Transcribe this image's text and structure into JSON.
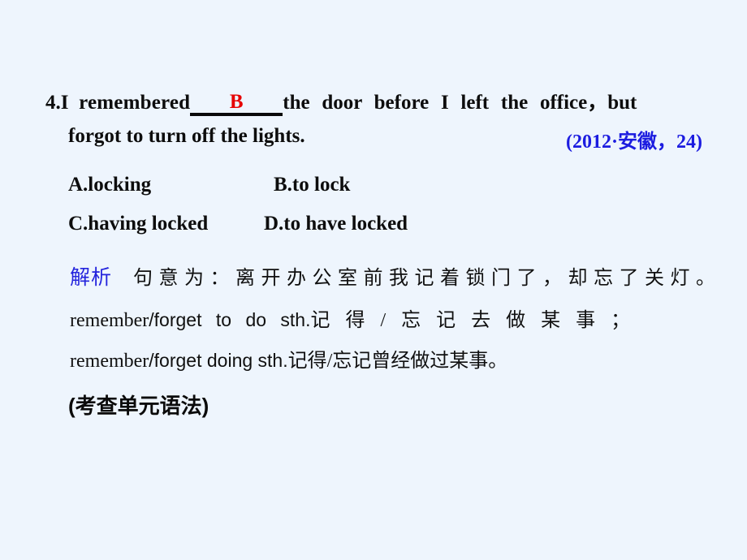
{
  "slide": {
    "background_color": "#eef5fd",
    "text_color": "#0d0d0d",
    "accent_blue": "#1c1ce0",
    "answer_red": "#e60000"
  },
  "question": {
    "number": "4.",
    "stem_before_blank": "I  remembered",
    "answer": "B",
    "stem_after_blank": "the  door  before  I  left  the  office，but",
    "stem_line2": "forgot to turn off the lights.",
    "citation": "(2012·安徽，24)"
  },
  "options": [
    {
      "key": "A",
      "label": "A.locking"
    },
    {
      "key": "B",
      "label": "B.to lock"
    },
    {
      "key": "C",
      "label": "C.having locked"
    },
    {
      "key": "D",
      "label": "D.to have locked"
    }
  ],
  "explanation": {
    "label": "解析",
    "line1_cn": "句意为：离开办公室前我记着锁门了，却忘了关灯。",
    "line2_en_serif": "remember",
    "line2_en_sans": "/forget  to  do  sth.",
    "line2_cn": "记 得 / 忘 记 去 做 某 事 ；",
    "line3_en_serif": "remember",
    "line3_en_sans": "/forget doing sth.",
    "line3_cn": "记得/忘记曾经做过某事。"
  },
  "footer": {
    "note": "(考查单元语法)"
  }
}
